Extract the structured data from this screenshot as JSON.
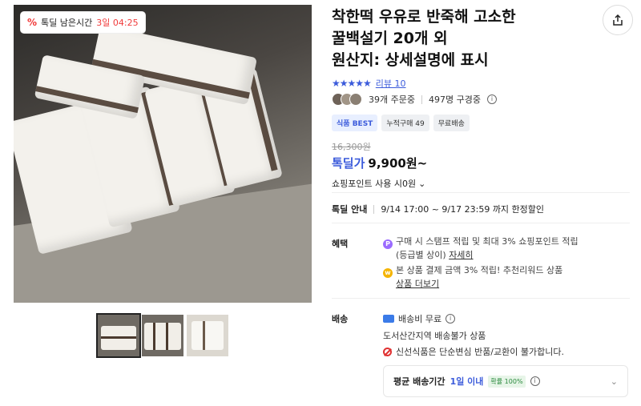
{
  "deal_badge": {
    "icon": "percent-icon",
    "text": "톡딜 남은시간",
    "remaining": "3일 04:25"
  },
  "product": {
    "title_line1": "착한떡 우유로 반죽해 고소한",
    "title_line2": "꿀백설기 20개 외",
    "title_line3": "원산지: 상세설명에 표시",
    "rating_stars": "★★★★★",
    "review_label": "리뷰 10",
    "orders": "39개 주문중",
    "subscribers": "497명 구경중",
    "tags": [
      "식품 BEST",
      "누적구매 49",
      "무료배송"
    ]
  },
  "pricing": {
    "original": "16,300원",
    "deal_label": "톡딜가",
    "deal_price": "9,900원~",
    "point_text": "쇼핑포인트 사용 시0원"
  },
  "deal_info": {
    "label": "톡딜 안내",
    "period": "9/14 17:00 ~ 9/17 23:59 까지 한정할인"
  },
  "benefits": {
    "label": "혜택",
    "line1": "구매 시 스탬프 적립 및 최대 3% 쇼핑포인트 적립",
    "line1b": "(등급별 상이)",
    "line1_link": "자세히",
    "line2": "본 상품 결제 금액 3% 적립! 추천리워드 상품",
    "line2_link": "상품 더보기"
  },
  "shipping": {
    "label": "배송",
    "free": "배송비 무료",
    "remote": "도서산간지역 배송불가 상품",
    "fresh": "신선식품은 단순변심 반품/교환이 불가합니다.",
    "avg_label": "평균 배송기간",
    "avg_value": "1일 이내",
    "prob": "확률 100%"
  },
  "colors": {
    "accent": "#3b5bdb",
    "deal_red": "#f03a3a"
  }
}
